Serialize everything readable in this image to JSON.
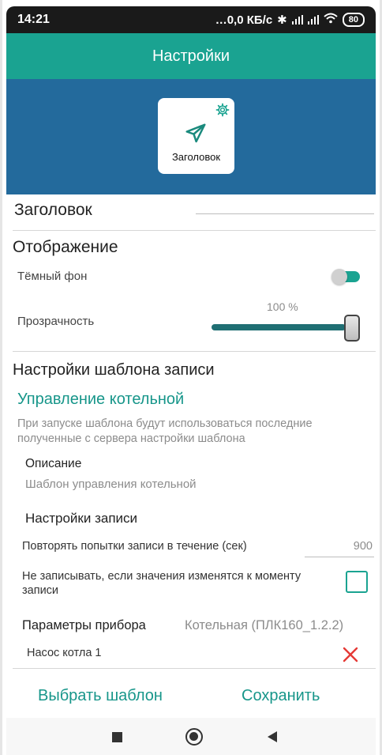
{
  "status_bar": {
    "time": "14:21",
    "network": "…0,0 КБ/с",
    "battery": "80"
  },
  "app_bar": {
    "title": "Настройки"
  },
  "preview": {
    "tile_label": "Заголовок"
  },
  "header_field": {
    "label": "Заголовок",
    "value": ""
  },
  "display": {
    "section_title": "Отображение",
    "dark_bg_label": "Тёмный фон",
    "dark_bg_on": true,
    "opacity_label": "Прозрачность",
    "opacity_value_text": "100 %",
    "opacity_value": 100
  },
  "template": {
    "section_title": "Настройки шаблона записи",
    "name": "Управление котельной",
    "note": "При запуске шаблона будут использоваться последние полученные с сервера настройки шаблона",
    "description_label": "Описание",
    "description_value": "Шаблон управления котельной",
    "record_settings_title": "Настройки записи",
    "retry_label": "Повторять попытки записи в течение (сек)",
    "retry_value": "900",
    "skip_label": "Не записывать, если значения изменятся к моменту записи",
    "skip_checked": false,
    "device_params_label": "Параметры прибора",
    "device_params_value": "Котельная (ПЛК160_1.2.2)",
    "param_item": "Насос котла 1"
  },
  "actions": {
    "choose_template": "Выбрать шаблон",
    "save": "Сохранить"
  },
  "colors": {
    "accent": "#1aa391",
    "header_blue": "#236a9c",
    "remove_red": "#e53935"
  }
}
